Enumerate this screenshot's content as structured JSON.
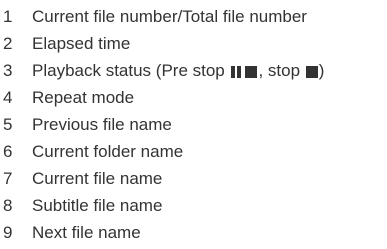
{
  "legend": [
    {
      "num": "1",
      "text": "Current file number/Total file number"
    },
    {
      "num": "2",
      "text": "Elapsed time"
    },
    {
      "num": "3",
      "text_before": "Playback status (Pre stop ",
      "text_mid": ", stop ",
      "text_after": ")",
      "symbols": {
        "pre_stop": "pause-stop-icon",
        "stop": "stop-icon"
      }
    },
    {
      "num": "4",
      "text": "Repeat mode"
    },
    {
      "num": "5",
      "text": "Previous file name"
    },
    {
      "num": "6",
      "text": "Current folder name"
    },
    {
      "num": "7",
      "text": "Current file name"
    },
    {
      "num": "8",
      "text": "Subtitle file name"
    },
    {
      "num": "9",
      "text": "Next file name"
    }
  ],
  "colors": {
    "text": "#333333",
    "background": "#ffffff"
  }
}
